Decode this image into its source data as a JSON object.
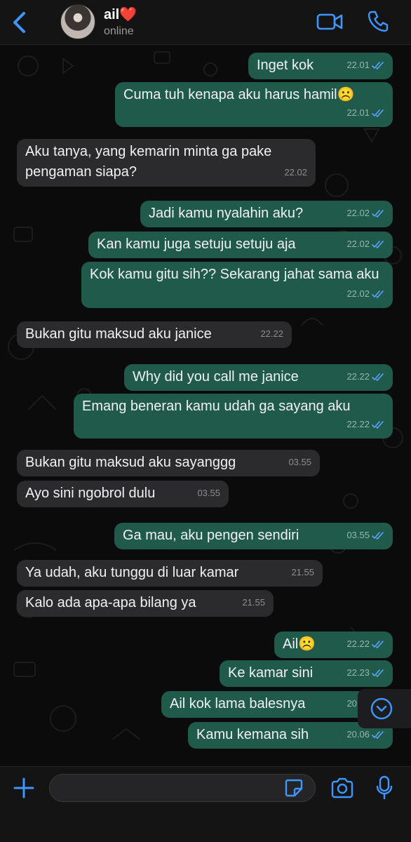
{
  "header": {
    "contact_name": "ail❤️",
    "contact_status": "online"
  },
  "messages": [
    {
      "dir": "out",
      "text": "Inget kok",
      "time": "22.01"
    },
    {
      "dir": "out",
      "text": "Cuma tuh kenapa aku harus hamil☹️",
      "time": "22.01"
    },
    {
      "dir": "in",
      "text": "Aku tanya, yang kemarin minta ga pake pengaman siapa?",
      "time": "22.02"
    },
    {
      "dir": "out",
      "text": "Jadi kamu nyalahin aku?",
      "time": "22.02"
    },
    {
      "dir": "out",
      "text": "Kan kamu juga setuju setuju aja",
      "time": "22.02"
    },
    {
      "dir": "out",
      "text": "Kok kamu gitu sih?? Sekarang jahat sama aku",
      "time": "22.02"
    },
    {
      "dir": "in",
      "text": "Bukan gitu maksud aku janice",
      "time": "22.22"
    },
    {
      "dir": "out",
      "text": "Why did you call me janice",
      "time": "22.22"
    },
    {
      "dir": "out",
      "text": "Emang beneran kamu udah ga sayang aku",
      "time": "22.22"
    },
    {
      "dir": "in",
      "text": "Bukan gitu maksud aku sayanggg",
      "time": "03.55"
    },
    {
      "dir": "in",
      "text": "Ayo sini ngobrol dulu",
      "time": "03.55"
    },
    {
      "dir": "out",
      "text": "Ga mau, aku pengen sendiri",
      "time": "03.55"
    },
    {
      "dir": "in",
      "text": "Ya udah, aku tunggu di luar kamar",
      "time": "21.55"
    },
    {
      "dir": "in",
      "text": "Kalo ada apa-apa bilang ya",
      "time": "21.55"
    },
    {
      "dir": "out",
      "text": "Ail☹️",
      "time": "22.22"
    },
    {
      "dir": "out",
      "text": "Ke kamar sini",
      "time": "22.23"
    },
    {
      "dir": "out",
      "text": "Ail kok lama balesnya",
      "time": "20.06"
    },
    {
      "dir": "out",
      "text": "Kamu kemana sih",
      "time": "20.06"
    }
  ],
  "input": {
    "placeholder": ""
  },
  "icons": {
    "back": "chevron-left-icon",
    "video": "video-camera-icon",
    "call": "phone-icon",
    "plus": "plus-icon",
    "sticker": "sticker-icon",
    "camera": "camera-icon",
    "mic": "microphone-icon",
    "scroll_down": "chevron-down-circle-icon"
  },
  "colors": {
    "accent": "#3e97ff",
    "outgoing_bubble": "#1f5a4b",
    "incoming_bubble": "#2b2b2d",
    "read_ticks": "#5fa3ff"
  }
}
